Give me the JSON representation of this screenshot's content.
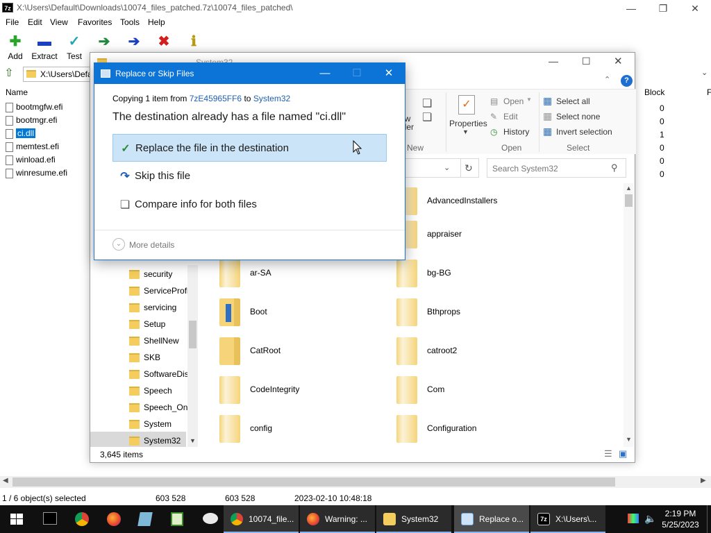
{
  "zip_window": {
    "title_icon": "7z",
    "title": "X:\\Users\\Default\\Downloads\\10074_files_patched.7z\\10074_files_patched\\",
    "menu": [
      "File",
      "Edit",
      "View",
      "Favorites",
      "Tools",
      "Help"
    ],
    "toolbar": [
      {
        "label": "Add",
        "icon": "plus-icon",
        "color": "#2aa52a"
      },
      {
        "label": "Extract",
        "icon": "minus-icon",
        "color": "#1a3fbf"
      },
      {
        "label": "Test",
        "icon": "check-icon",
        "color": "#23a7b5"
      },
      {
        "label": "",
        "icon": "copy-arrow-icon",
        "color": "#1e8b3c"
      },
      {
        "label": "",
        "icon": "move-arrow-icon",
        "color": "#1a3fbf"
      },
      {
        "label": "",
        "icon": "delete-x-icon",
        "color": "#d41e1e"
      },
      {
        "label": "",
        "icon": "info-icon",
        "color": "#d4b21e"
      }
    ],
    "address": "X:\\Users\\Defa",
    "columns": {
      "name": "Name",
      "block": "Block",
      "extra": "F"
    },
    "files": [
      {
        "name": "bootmgfw.efi",
        "block": "0",
        "selected": false
      },
      {
        "name": "bootmgr.efi",
        "block": "0",
        "selected": false
      },
      {
        "name": "ci.dll",
        "block": "1",
        "selected": true
      },
      {
        "name": "memtest.efi",
        "block": "0",
        "selected": false
      },
      {
        "name": "winload.efi",
        "block": "0",
        "selected": false
      },
      {
        "name": "winresume.efi",
        "block": "0",
        "selected": false
      }
    ],
    "status": {
      "selection": "1 / 6 object(s) selected",
      "size": "603 528",
      "packed": "603 528",
      "modified": "2023-02-10 10:48:18"
    }
  },
  "explorer": {
    "title": "System32",
    "ribbon": {
      "new_label": "New",
      "new_partial": "ew\nlder",
      "properties": "Properties",
      "open": "Open",
      "edit": "Edit",
      "history": "History",
      "open_group": "Open",
      "select_all": "Select all",
      "select_none": "Select none",
      "invert_selection": "Invert selection",
      "select_group": "Select"
    },
    "search_placeholder": "Search System32",
    "tree": [
      "security",
      "ServiceProfi",
      "servicing",
      "Setup",
      "ShellNew",
      "SKB",
      "SoftwareDis",
      "Speech",
      "Speech_One",
      "System",
      "System32"
    ],
    "grid_right_top": [
      "AdvancedInstallers",
      "appraiser"
    ],
    "grid_rows": [
      {
        "left": "ar-SA",
        "right": "bg-BG"
      },
      {
        "left": "Boot",
        "right": "Bthprops"
      },
      {
        "left": "CatRoot",
        "right": "catroot2"
      },
      {
        "left": "CodeIntegrity",
        "right": "Com"
      },
      {
        "left": "config",
        "right": "Configuration"
      }
    ],
    "item_count": "3,645 items"
  },
  "dialog": {
    "title": "Replace or Skip Files",
    "copying_prefix": "Copying 1 item from",
    "source": "7zE45965FF6",
    "to": "to",
    "destination": "System32",
    "heading": "The destination already has a file named \"ci.dll\"",
    "options": [
      {
        "label": "Replace the file in the destination",
        "icon": "checkmark-icon"
      },
      {
        "label": "Skip this file",
        "icon": "skip-arrow-icon"
      },
      {
        "label": "Compare info for both files",
        "icon": "compare-icon"
      }
    ],
    "more_details": "More details"
  },
  "taskbar": {
    "tasks": [
      {
        "label": "10074_file...",
        "icon": "chrome-icon"
      },
      {
        "label": "Warning: ...",
        "icon": "firefox-icon"
      },
      {
        "label": "System32",
        "icon": "folder-icon"
      },
      {
        "label": "Replace o...",
        "icon": "replace-dialog-icon"
      },
      {
        "label": "X:\\Users\\...",
        "icon": "7zip-icon"
      }
    ],
    "time": "2:19 PM",
    "date": "5/25/2023"
  }
}
